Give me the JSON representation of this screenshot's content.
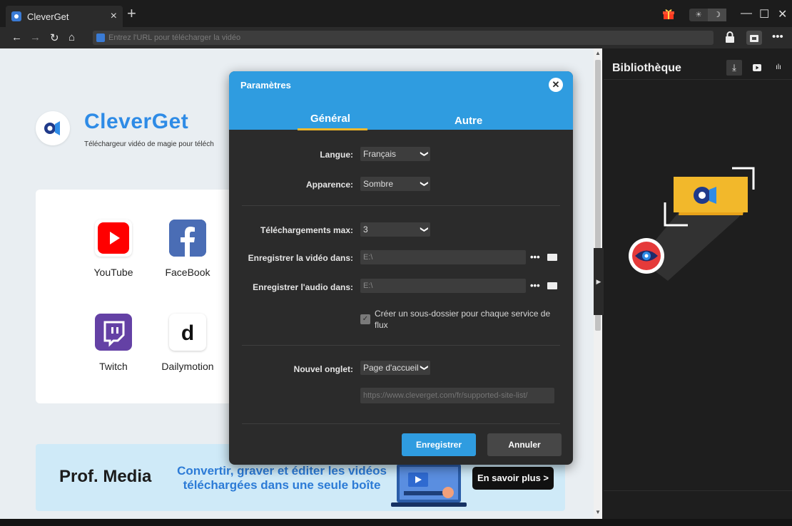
{
  "browser": {
    "tab_title": "CleverGet",
    "tab_close": "×",
    "new_tab": "+",
    "url_placeholder": "Entrez l'URL pour télécharger la vidéo",
    "theme_light": "☀",
    "theme_dark": "☽"
  },
  "home": {
    "brand_name": "CleverGet",
    "tagline": "Téléchargeur vidéo de magie pour téléch",
    "sites": [
      {
        "label": "YouTube",
        "icon": "youtube-icon",
        "color": "#ff0000"
      },
      {
        "label": "FaceBook",
        "icon": "facebook-icon",
        "color": "#3b5998"
      },
      {
        "label": "Twitch",
        "icon": "twitch-icon",
        "color": "#6441a5"
      },
      {
        "label": "Dailymotion",
        "icon": "dailymotion-icon",
        "color": "#ffffff"
      }
    ],
    "banner": {
      "title": "Prof. Media",
      "promo_line1": "Convertir, graver et éditer les vidéos",
      "promo_line2": "téléchargées dans une seule boîte",
      "cta": "En savoir plus >"
    }
  },
  "library": {
    "title": "Bibliothèque",
    "icons": [
      "download-icon",
      "video-icon",
      "audio-icon"
    ]
  },
  "settings": {
    "title": "Paramètres",
    "tabs": [
      {
        "label": "Général",
        "active": true
      },
      {
        "label": "Autre",
        "active": false
      }
    ],
    "language_label": "Langue:",
    "language_value": "Français",
    "appearance_label": "Apparence:",
    "appearance_value": "Sombre",
    "max_downloads_label": "Téléchargements max:",
    "max_downloads_value": "3",
    "video_dir_label": "Enregistrer la vidéo dans:",
    "video_dir_value": "E:\\",
    "audio_dir_label": "Enregistrer l'audio dans:",
    "audio_dir_value": "E:\\",
    "subfolder_label": "Créer un sous-dossier pour chaque service de flux",
    "subfolder_checked": true,
    "new_tab_label": "Nouvel onglet:",
    "new_tab_value": "Page d'accueil",
    "new_tab_url_placeholder": "https://www.cleverget.com/fr/supported-site-list/",
    "save_button": "Enregistrer",
    "cancel_button": "Annuler",
    "more_glyph": "•••"
  },
  "colors": {
    "accent": "#2f9ce0",
    "brand": "#2e8be6",
    "tab_underline": "#f2b82b"
  }
}
